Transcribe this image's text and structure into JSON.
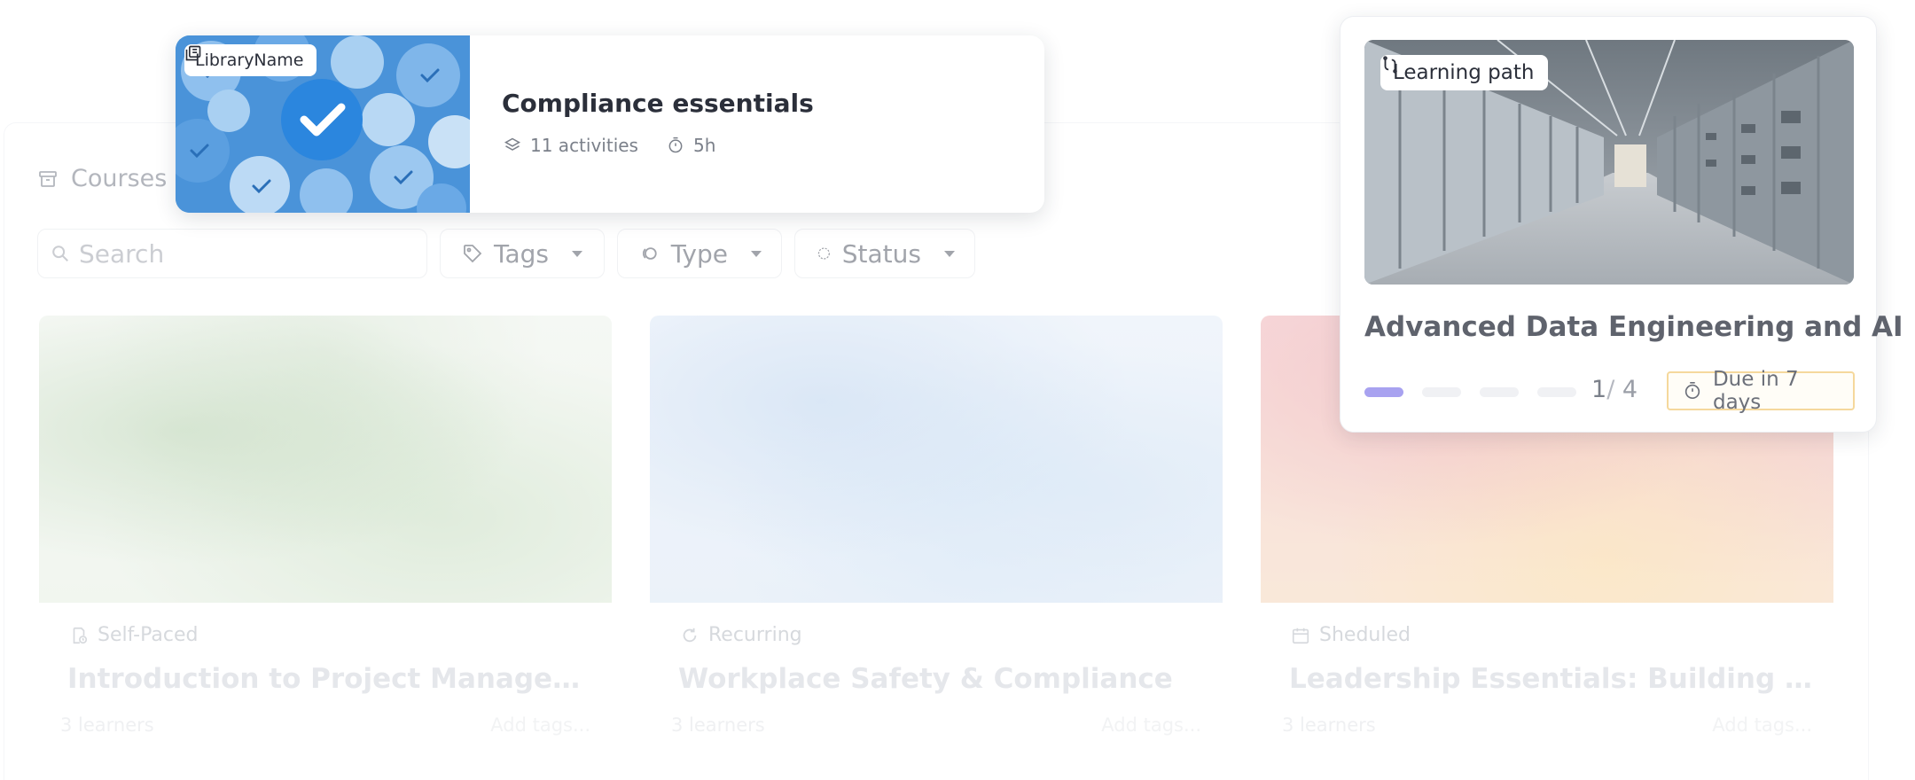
{
  "courses_panel": {
    "title": "Courses",
    "search": {
      "placeholder": "Search"
    },
    "filters": {
      "tags": "Tags",
      "type": "Type",
      "status": "Status"
    }
  },
  "course_cards": [
    {
      "type_label": "Self-Paced",
      "type_icon": "self-paced-icon",
      "title": "Introduction to Project Management",
      "learners": "3 learners",
      "add_tags": "Add tags..."
    },
    {
      "type_label": "Recurring",
      "type_icon": "recurring-icon",
      "title": "Workplace Safety & Compliance",
      "learners": "3 learners",
      "add_tags": "Add tags..."
    },
    {
      "type_label": "Sheduled",
      "type_icon": "calendar-icon",
      "title": "Leadership Essentials: Building Strong Teams",
      "learners": "3 learners",
      "add_tags": "Add tags..."
    }
  ],
  "library_card": {
    "badge": "LibraryName",
    "title": "Compliance essentials",
    "activities": "11 activities",
    "duration": "5h"
  },
  "learning_path_card": {
    "badge": "Learning path",
    "title": "Advanced Data Engineering and AI",
    "progress_current": "1",
    "progress_separator": "/",
    "progress_total": "4",
    "progress_fraction": 0.25,
    "due": "Due in 7 days",
    "accent_color": "#a8a2f0",
    "due_border_color": "#f5d89c"
  }
}
